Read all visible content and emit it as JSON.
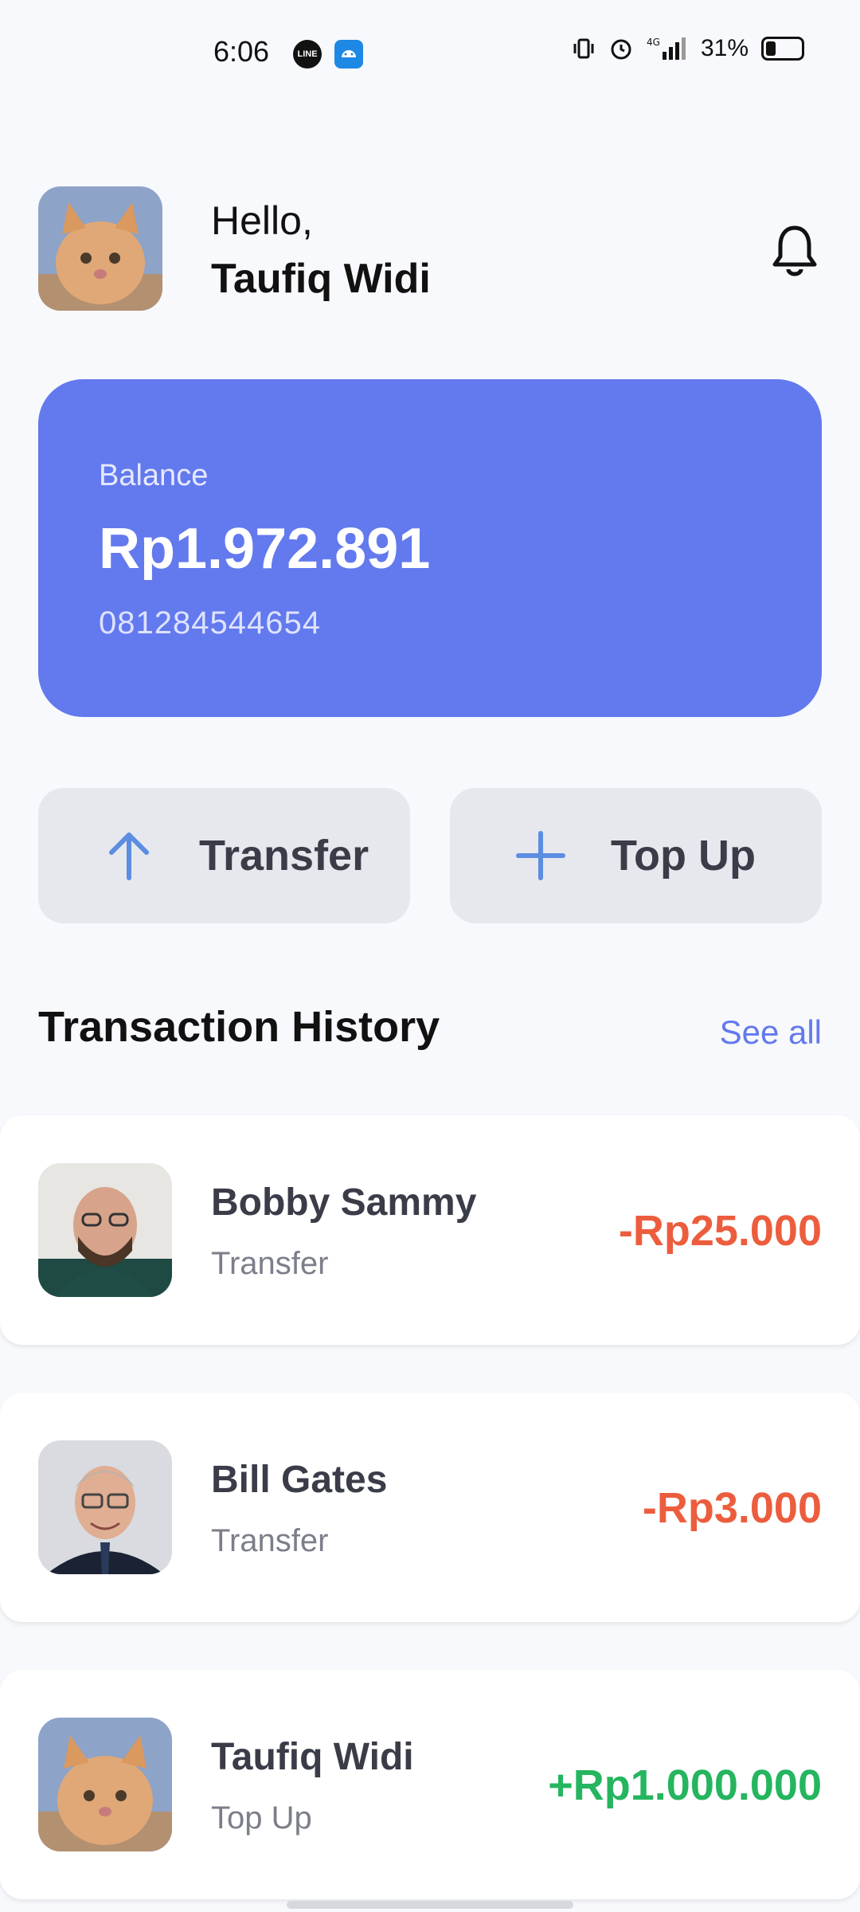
{
  "status_bar": {
    "time": "6:06",
    "battery": "31%",
    "line_app": "LINE",
    "icons": [
      "line-app-icon",
      "android-app-icon",
      "vibrate-icon",
      "alarm-icon",
      "signal-4g-icon",
      "battery-icon"
    ]
  },
  "header": {
    "greeting": "Hello,",
    "user_name": "Taufiq Widi",
    "icons": [
      "avatar",
      "bell-icon"
    ]
  },
  "balance": {
    "label": "Balance",
    "amount": "Rp1.972.891",
    "phone": "081284544654",
    "card_color": "#6379ee"
  },
  "actions": [
    {
      "label": "Transfer",
      "icon": "arrow-up-icon"
    },
    {
      "label": "Top Up",
      "icon": "plus-icon"
    }
  ],
  "history": {
    "title": "Transaction History",
    "see_all": "See all",
    "items": [
      {
        "name": "Bobby Sammy",
        "type": "Transfer",
        "amount": "-Rp25.000",
        "direction": "out"
      },
      {
        "name": "Bill Gates",
        "type": "Transfer",
        "amount": "-Rp3.000",
        "direction": "out"
      },
      {
        "name": "Taufiq Widi",
        "type": "Top Up",
        "amount": "+Rp1.000.000",
        "direction": "in"
      }
    ]
  },
  "colors": {
    "accent": "#6379ee",
    "negative": "#ec5d3e",
    "positive": "#25b55f",
    "background": "#f7f9fc"
  }
}
